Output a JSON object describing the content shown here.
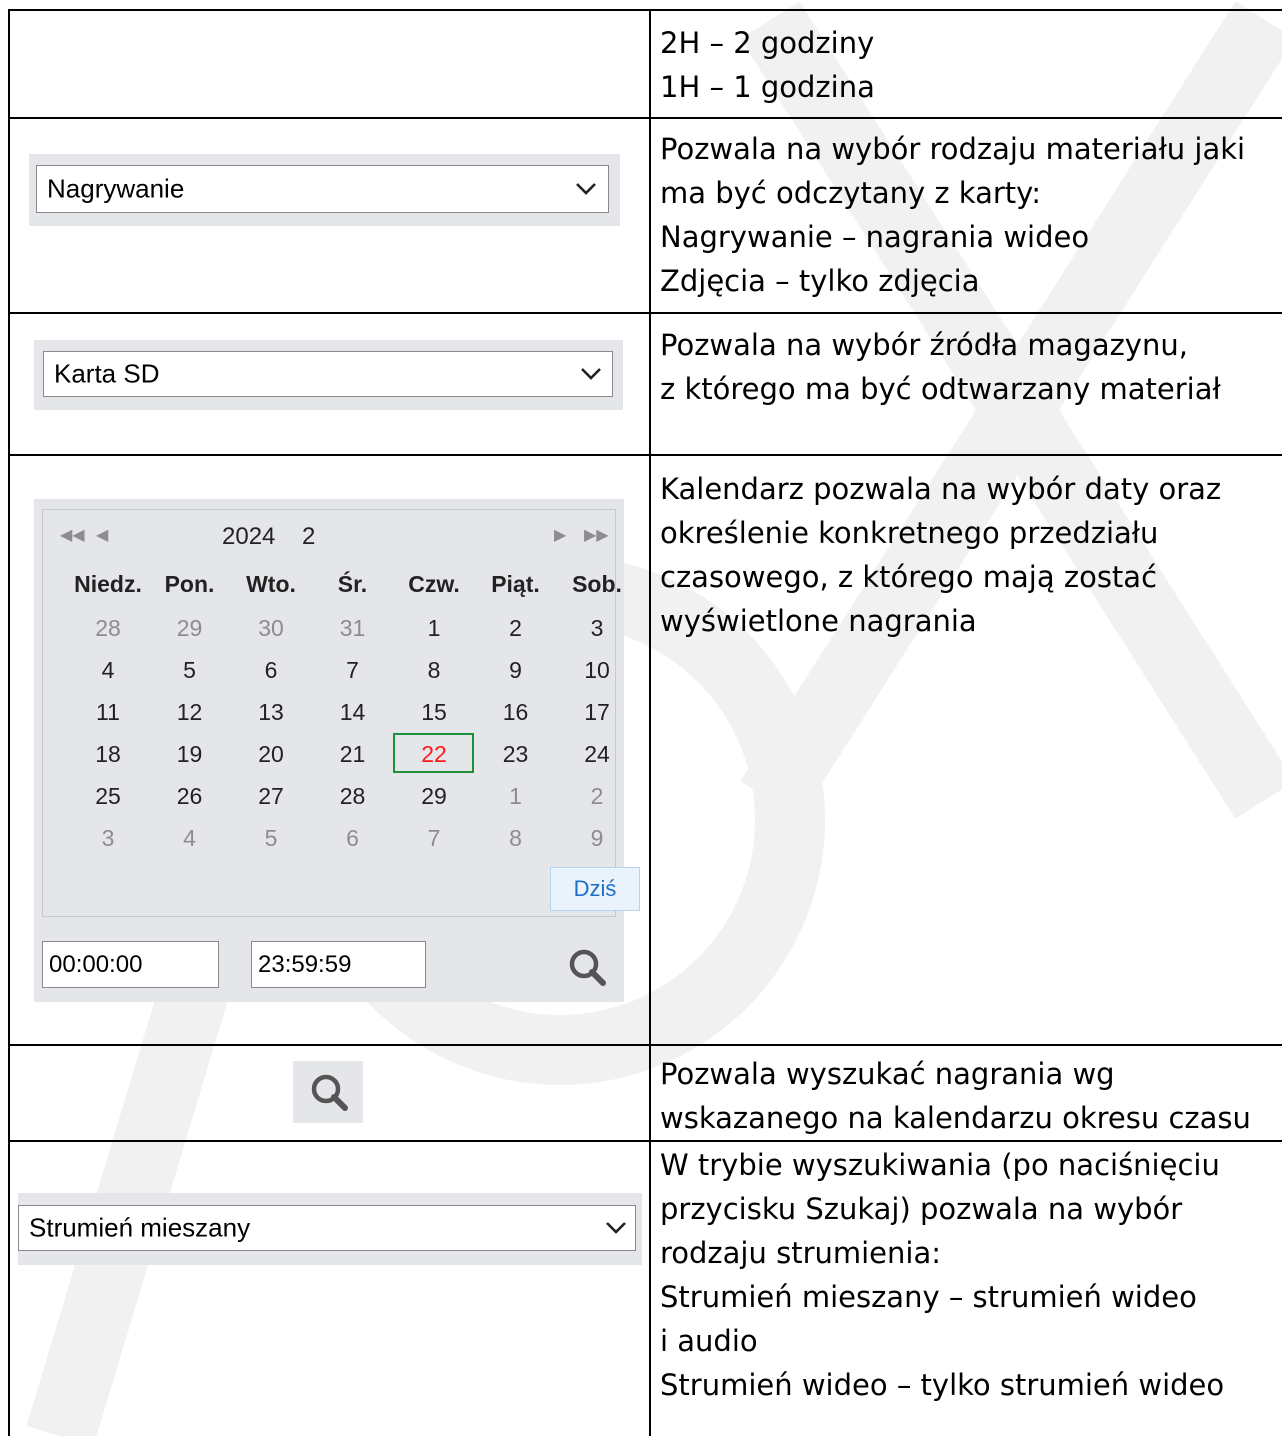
{
  "watermark": "IPOX",
  "rows": [
    {
      "description": [
        "2H – 2 godziny",
        "1H – 1 godzina"
      ]
    },
    {
      "control": {
        "value": "Nagrywanie",
        "icon": "chevron-down-icon"
      },
      "description": [
        "Pozwala na wybór rodzaju materiału jaki",
        "ma być odczytany z karty:",
        "Nagrywanie – nagrania wideo",
        "Zdjęcia – tylko zdjęcia"
      ]
    },
    {
      "control": {
        "value": "Karta SD",
        "icon": "chevron-down-icon"
      },
      "description": [
        "Pozwala na wybór źródła magazynu,",
        "z którego ma być odtwarzany materiał"
      ]
    },
    {
      "description": [
        "Kalendarz pozwala na wybór daty oraz",
        "określenie konkretnego przedziału",
        "czasowego, z którego mają zostać",
        "wyświetlone nagrania"
      ]
    },
    {
      "control": {
        "icon": "search-icon"
      },
      "description": [
        "Pozwala wyszukać nagrania wg",
        "wskazanego na kalendarzu okresu czasu"
      ]
    },
    {
      "control": {
        "value": "Strumień mieszany",
        "icon": "chevron-down-icon"
      },
      "description": [
        "W trybie wyszukiwania (po naciśnięciu",
        "przycisku Szukaj) pozwala na wybór",
        "rodzaju strumienia:",
        "Strumień mieszany – strumień wideo",
        "i audio",
        "Strumień wideo – tylko strumień wideo"
      ]
    }
  ],
  "calendar": {
    "year": "2024",
    "month": "2",
    "nav_icons": [
      "double-left-icon",
      "left-icon",
      "right-icon",
      "double-right-icon"
    ],
    "weekdays": [
      "Niedz.",
      "Pon.",
      "Wto.",
      "Śr.",
      "Czw.",
      "Piąt.",
      "Sob."
    ],
    "weeks": [
      [
        [
          "28",
          "muted"
        ],
        [
          "29",
          "muted"
        ],
        [
          "30",
          "muted"
        ],
        [
          "31",
          "muted"
        ],
        [
          "1",
          ""
        ],
        [
          "2",
          ""
        ],
        [
          "3",
          ""
        ]
      ],
      [
        [
          "4",
          ""
        ],
        [
          "5",
          ""
        ],
        [
          "6",
          ""
        ],
        [
          "7",
          ""
        ],
        [
          "8",
          ""
        ],
        [
          "9",
          ""
        ],
        [
          "10",
          ""
        ]
      ],
      [
        [
          "11",
          ""
        ],
        [
          "12",
          ""
        ],
        [
          "13",
          ""
        ],
        [
          "14",
          ""
        ],
        [
          "15",
          ""
        ],
        [
          "16",
          ""
        ],
        [
          "17",
          ""
        ]
      ],
      [
        [
          "18",
          ""
        ],
        [
          "19",
          ""
        ],
        [
          "20",
          ""
        ],
        [
          "21",
          ""
        ],
        [
          "22",
          "selected"
        ],
        [
          "23",
          ""
        ],
        [
          "24",
          ""
        ]
      ],
      [
        [
          "25",
          ""
        ],
        [
          "26",
          ""
        ],
        [
          "27",
          ""
        ],
        [
          "28",
          ""
        ],
        [
          "29",
          ""
        ],
        [
          "1",
          "muted"
        ],
        [
          "2",
          "muted"
        ]
      ],
      [
        [
          "3",
          "muted"
        ],
        [
          "4",
          "muted"
        ],
        [
          "5",
          "muted"
        ],
        [
          "6",
          "muted"
        ],
        [
          "7",
          "muted"
        ],
        [
          "8",
          "muted"
        ],
        [
          "9",
          "muted"
        ]
      ]
    ],
    "today_label": "Dziś",
    "time_from": "00:00:00",
    "time_separator": "-",
    "time_to": "23:59:59",
    "colors": {
      "selected_day": "#ff1a1a",
      "selected_border": "#1f8f3a",
      "today_text": "#1f6fc4",
      "panel_bg": "#e5e6ea"
    }
  }
}
